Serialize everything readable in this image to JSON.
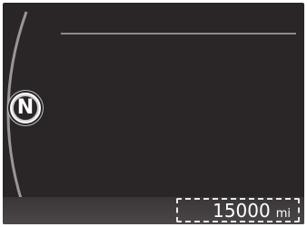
{
  "display": {
    "gear": "N",
    "odometer": {
      "value": "15000",
      "unit": "mi"
    }
  },
  "colors": {
    "background": "#2a2526",
    "accent_line": "#8e8a8b",
    "text": "#ffffff"
  }
}
